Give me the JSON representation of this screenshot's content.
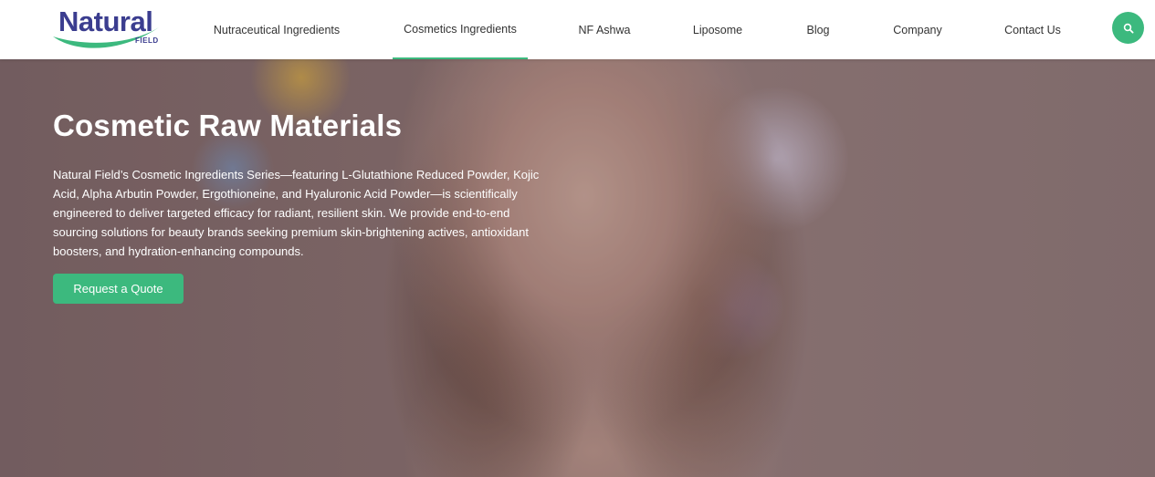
{
  "brand": {
    "name": "Natural",
    "sub": "FIELD"
  },
  "nav": [
    {
      "label": "Nutraceutical Ingredients"
    },
    {
      "label": "Cosmetics Ingredients",
      "active": true
    },
    {
      "label": "NF Ashwa"
    },
    {
      "label": "Liposome"
    },
    {
      "label": "Blog"
    },
    {
      "label": "Company"
    },
    {
      "label": "Contact Us"
    }
  ],
  "search": {
    "icon": "search-icon"
  },
  "hero": {
    "title": "Cosmetic Raw Materials",
    "description": "Natural Field’s Cosmetic Ingredients Series—featuring L-Glutathione Reduced Powder, Kojic Acid, Alpha Arbutin Powder, Ergothioneine, and Hyaluronic Acid Powder—is scientifically engineered to deliver targeted efficacy for radiant, resilient skin. We provide end-to-end sourcing solutions for beauty brands seeking premium skin-brightening actives, antioxidant boosters, and hydration-enhancing compounds.",
    "cta_label": "Request a Quote"
  },
  "colors": {
    "accent": "#3cb97e",
    "brand": "#3b3d8f"
  }
}
